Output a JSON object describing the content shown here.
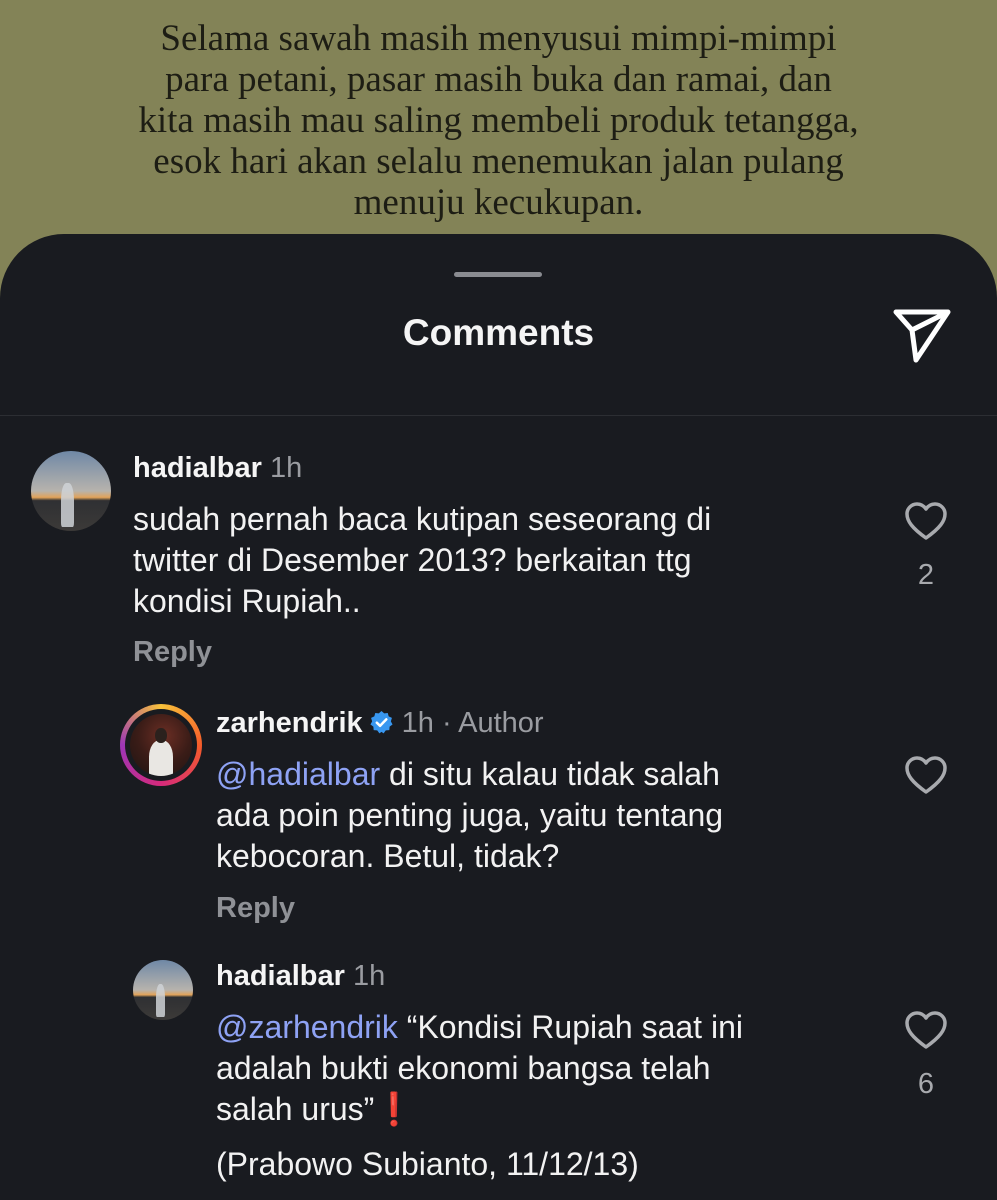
{
  "quote": {
    "text": "Selama sawah masih menyusui mimpi-mimpi\npara petani, pasar masih buka dan ramai, dan\nkita masih mau saling membeli produk tetangga,\nesok hari akan selalu menemukan jalan pulang\nmenuju kecukupan."
  },
  "sheet": {
    "title": "Comments",
    "share_icon": "send-icon"
  },
  "comments": [
    {
      "username": "hadialbar",
      "time": "1h",
      "text": "sudah pernah baca kutipan seseorang di\ntwitter di Desember 2013? berkaitan ttg\nkondisi Rupiah..",
      "reply_label": "Reply",
      "likes": "2"
    },
    {
      "username": "zarhendrik",
      "verified": true,
      "time": "1h",
      "author_label": "· Author",
      "mention": "@hadialbar",
      "text": " di situ kalau tidak salah\nada poin penting juga, yaitu tentang\nkebocoran. Betul, tidak?",
      "reply_label": "Reply"
    },
    {
      "username": "hadialbar",
      "time": "1h",
      "mention": "@zarhendrik",
      "text": " “Kondisi Rupiah saat ini\nadalah bukti ekonomi bangsa telah\nsalah urus”",
      "emoji": "❗",
      "text2": "(Prabowo Subianto, 11/12/13)",
      "likes": "6"
    }
  ],
  "colors": {
    "quote_bg": "#838357",
    "sheet_bg": "#191b20",
    "mention": "#8ea2f4",
    "verified": "#3897f0"
  }
}
